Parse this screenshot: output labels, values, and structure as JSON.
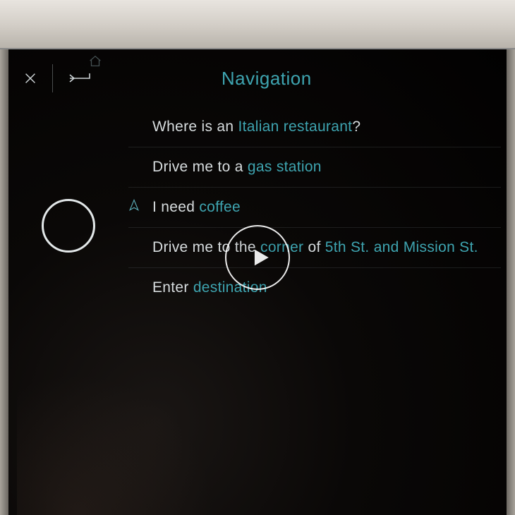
{
  "header": {
    "title": "Navigation"
  },
  "prompts": [
    {
      "prefix": "Where is an ",
      "accent": "Italian restaurant",
      "suffix": "?",
      "active": false
    },
    {
      "prefix": "Drive me to a ",
      "accent": "gas station",
      "suffix": "",
      "active": false
    },
    {
      "prefix": "I need ",
      "accent": "coffee",
      "suffix": "",
      "active": true
    },
    {
      "prefix": "Drive me to the ",
      "accent": "corner",
      "mid": " of ",
      "accent2": "5th St. and Mission St.",
      "suffix": "",
      "active": false
    },
    {
      "prefix": "Enter ",
      "accent": "destination",
      "suffix": "",
      "active": false
    }
  ],
  "icons": {
    "close": "close",
    "back": "back",
    "home": "home",
    "navArrow": "navigation-arrow",
    "play": "play"
  }
}
